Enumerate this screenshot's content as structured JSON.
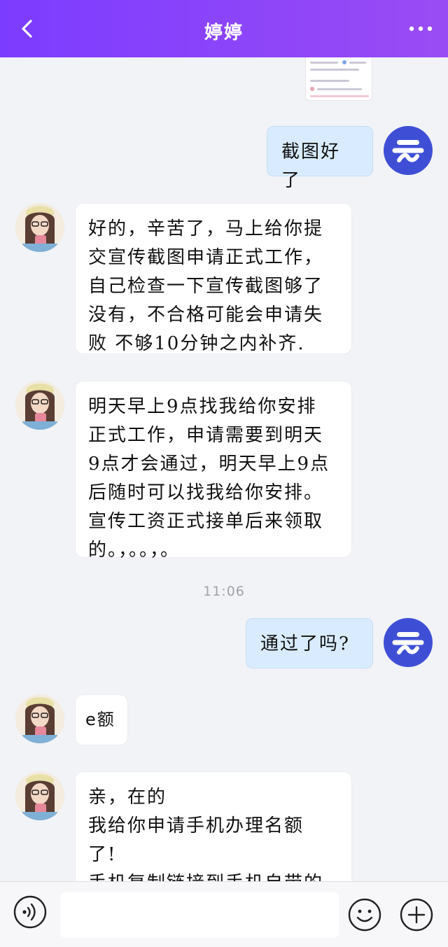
{
  "header": {
    "title": "婷婷",
    "back_icon": "chevron-left-icon",
    "more_icon": "more-horizontal-icon"
  },
  "colors": {
    "header_gradient_start": "#7c3cff",
    "header_gradient_end": "#9a4cf4",
    "sent_bubble": "#d9ecff",
    "received_bubble": "#ffffff",
    "background": "#f2f3f7",
    "my_avatar": "#3e4fd6"
  },
  "messages": [
    {
      "from": "me",
      "text": "截图好了"
    },
    {
      "from": "other",
      "text": "好的，辛苦了，马上给你提\n交宣传截图申请正式工作，\n自己检查一下宣传截图够了\n没有，不合格可能会申请失\n败 不够10分钟之内补齐."
    },
    {
      "from": "other",
      "text": "明天早上9点找我给你安排\n正式工作，申请需要到明天\n9点才会通过，明天早上9点\n后随时可以找我给你安排。\n宣传工资正式接单后来领取\n的。，。。，。"
    },
    {
      "from": "me",
      "text": "通过了吗?"
    },
    {
      "from": "other",
      "text": "e额"
    },
    {
      "from": "other",
      "text": "亲，在的\n我给你申请手机办理名额\n了!\n手机复制链接到手机自带的"
    }
  ],
  "timestamp": "11:06",
  "input": {
    "placeholder": "",
    "voice_icon": "voice-icon",
    "emoji_icon": "emoji-icon",
    "plus_icon": "plus-icon"
  }
}
